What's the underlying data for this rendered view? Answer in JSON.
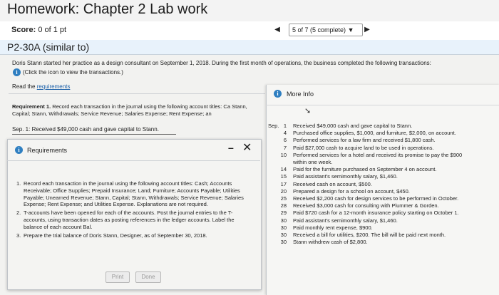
{
  "header": {
    "title": "Homework: Chapter 2 Lab work",
    "score_label": "Score:",
    "score_value": "0 of 1 pt",
    "question_selector": "5 of 7 (5 complete)",
    "prev_glyph": "◀",
    "next_glyph": "▶",
    "dropdown_glyph": "▼"
  },
  "question": {
    "title": "P2-30A (similar to)",
    "intro": "Doris Stann started her practice as a design consultant on September 1, 2018. During the first month of operations, the business completed the following transactions:",
    "click_hint": "(Click the icon to view the transactions.)",
    "read_prefix": "Read the ",
    "read_link": "requirements"
  },
  "requirement1": {
    "label": "Requirement 1.",
    "text": " Record each transaction in the journal using the following account titles: Ca Stann, Capital; Stann, Withdrawals; Service Revenue; Salaries Expense; Rent Expense; an",
    "sep_line": "Sep. 1: Received $49,000 cash and gave capital to Stann."
  },
  "requirements_popup": {
    "title": "Requirements",
    "minimize": "–",
    "close": "✕",
    "items": [
      {
        "num": "1.",
        "text": "Record each transaction in the journal using the following account titles: Cash; Accounts Receivable; Office Supplies; Prepaid Insurance; Land; Furniture; Accounts Payable; Utilities Payable; Unearned Revenue; Stann, Capital; Stann, Withdrawals; Service Revenue; Salaries Expense; Rent Expense; and Utilities Expense. Explanations are not required."
      },
      {
        "num": "2.",
        "text": "T-accounts have been opened for each of the accounts. Post the journal entries to the T-accounts, using transaction dates as posting references in the ledger accounts. Label the balance of each account Bal."
      },
      {
        "num": "3.",
        "text": "Prepare the trial balance of Doris Stann, Designer, as of September 30, 2018."
      }
    ],
    "print_label": "Print",
    "done_label": "Done"
  },
  "more_info": {
    "title": "More Info",
    "month": "Sep.",
    "transactions": [
      {
        "day": "1",
        "text": "Received $49,000 cash and gave capital to Stann."
      },
      {
        "day": "4",
        "text": "Purchased office supplies, $1,000, and furniture, $2,000, on account."
      },
      {
        "day": "6",
        "text": "Performed services for a law firm and received $1,800 cash."
      },
      {
        "day": "7",
        "text": "Paid $27,000 cash to acquire land to be used in operations."
      },
      {
        "day": "10",
        "text": "Performed services for a hotel and received its promise to pay the $900"
      },
      {
        "day": "",
        "text": "within one week."
      },
      {
        "day": "14",
        "text": "Paid for the furniture purchased on September 4 on account."
      },
      {
        "day": "15",
        "text": "Paid assistant's semimonthly salary, $1,460."
      },
      {
        "day": "17",
        "text": "Received cash on account, $500."
      },
      {
        "day": "20",
        "text": "Prepared a design for a school on account, $450."
      },
      {
        "day": "25",
        "text": "Received $2,200 cash for design services to be performed in October."
      },
      {
        "day": "28",
        "text": "Received $3,000 cash for consulting with Plummer & Gorden."
      },
      {
        "day": "29",
        "text": "Paid $720 cash for a 12-month insurance policy starting on October 1."
      },
      {
        "day": "30",
        "text": "Paid assistant's semimonthly salary, $1,460."
      },
      {
        "day": "30",
        "text": "Paid monthly rent expense, $900."
      },
      {
        "day": "30",
        "text": "Received a bill for utilities, $200. The bill will be paid next month."
      },
      {
        "day": "30",
        "text": "Stann withdrew cash of $2,800."
      }
    ]
  },
  "colors": {
    "info_icon": "#2f7fc1",
    "link": "#1a5fa8",
    "question_header_bg": "#e8f2fb"
  },
  "icons": {
    "info": "info-circle-icon",
    "minimize": "minimize-icon",
    "close": "close-icon",
    "cursor": "mouse-pointer-icon"
  }
}
